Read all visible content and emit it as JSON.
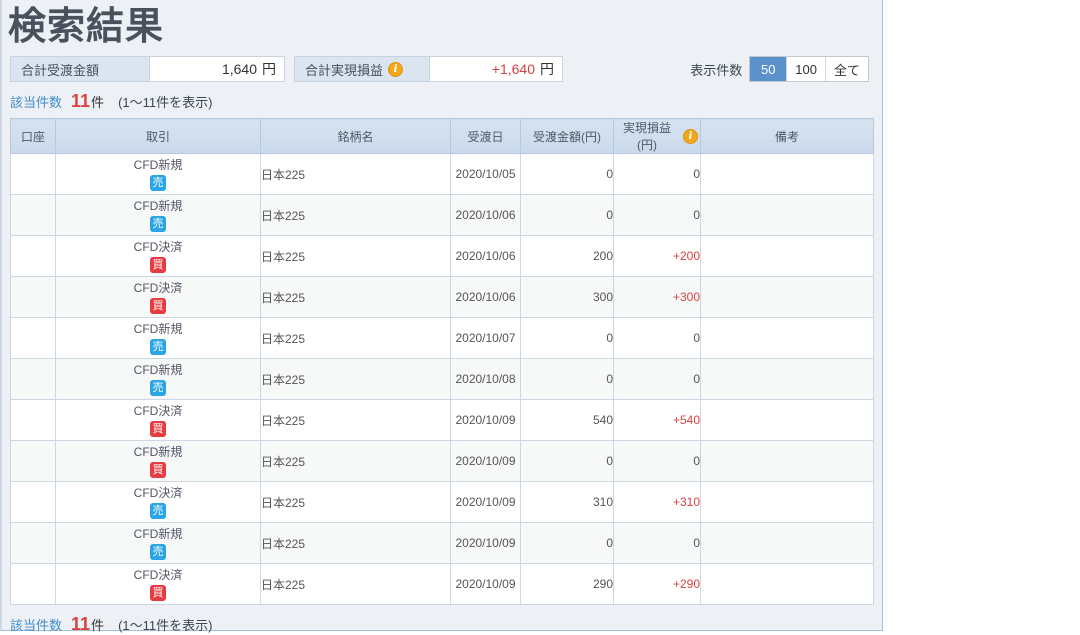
{
  "page": {
    "title": "検索結果"
  },
  "summary": {
    "settlement": {
      "label": "合計受渡金額",
      "value": "1,640",
      "unit": "円"
    },
    "realized_pl": {
      "label": "合計実現損益",
      "value": "+1,640",
      "unit": "円"
    }
  },
  "display_count": {
    "label": "表示件数",
    "options": [
      "50",
      "100",
      "全て"
    ],
    "selected": "50"
  },
  "result_count": {
    "label": "該当件数",
    "count": "11",
    "unit": "件",
    "range": "(1〜11件を表示)"
  },
  "table": {
    "headers": [
      "口座",
      "取引",
      "銘柄名",
      "受渡日",
      "受渡金額(円)",
      "実現損益(円)",
      "備考"
    ],
    "rows": [
      {
        "account": "",
        "trade_type": "CFD新規",
        "side": "売",
        "side_kind": "sell",
        "instrument": "日本225",
        "settle_date": "2020/10/05",
        "amount": "0",
        "realized_pl": "0",
        "note": ""
      },
      {
        "account": "",
        "trade_type": "CFD新規",
        "side": "売",
        "side_kind": "sell",
        "instrument": "日本225",
        "settle_date": "2020/10/06",
        "amount": "0",
        "realized_pl": "0",
        "note": ""
      },
      {
        "account": "",
        "trade_type": "CFD決済",
        "side": "買",
        "side_kind": "buy",
        "instrument": "日本225",
        "settle_date": "2020/10/06",
        "amount": "200",
        "realized_pl": "+200",
        "note": ""
      },
      {
        "account": "",
        "trade_type": "CFD決済",
        "side": "買",
        "side_kind": "buy",
        "instrument": "日本225",
        "settle_date": "2020/10/06",
        "amount": "300",
        "realized_pl": "+300",
        "note": ""
      },
      {
        "account": "",
        "trade_type": "CFD新規",
        "side": "売",
        "side_kind": "sell",
        "instrument": "日本225",
        "settle_date": "2020/10/07",
        "amount": "0",
        "realized_pl": "0",
        "note": ""
      },
      {
        "account": "",
        "trade_type": "CFD新規",
        "side": "売",
        "side_kind": "sell",
        "instrument": "日本225",
        "settle_date": "2020/10/08",
        "amount": "0",
        "realized_pl": "0",
        "note": ""
      },
      {
        "account": "",
        "trade_type": "CFD決済",
        "side": "買",
        "side_kind": "buy",
        "instrument": "日本225",
        "settle_date": "2020/10/09",
        "amount": "540",
        "realized_pl": "+540",
        "note": ""
      },
      {
        "account": "",
        "trade_type": "CFD新規",
        "side": "買",
        "side_kind": "buy",
        "instrument": "日本225",
        "settle_date": "2020/10/09",
        "amount": "0",
        "realized_pl": "0",
        "note": ""
      },
      {
        "account": "",
        "trade_type": "CFD決済",
        "side": "売",
        "side_kind": "sell",
        "instrument": "日本225",
        "settle_date": "2020/10/09",
        "amount": "310",
        "realized_pl": "+310",
        "note": ""
      },
      {
        "account": "",
        "trade_type": "CFD新規",
        "side": "売",
        "side_kind": "sell",
        "instrument": "日本225",
        "settle_date": "2020/10/09",
        "amount": "0",
        "realized_pl": "0",
        "note": ""
      },
      {
        "account": "",
        "trade_type": "CFD決済",
        "side": "買",
        "side_kind": "buy",
        "instrument": "日本225",
        "settle_date": "2020/10/09",
        "amount": "290",
        "realized_pl": "+290",
        "note": ""
      }
    ]
  },
  "colors": {
    "sell_badge": "#2aa4e4",
    "buy_badge": "#e63b40",
    "positive_red": "#d9433f",
    "selected_button_blue": "#5b92cb",
    "count_blue": "#3f8ccb",
    "header_bg": "#cfdded",
    "info_icon_orange": "#f2a71c"
  }
}
